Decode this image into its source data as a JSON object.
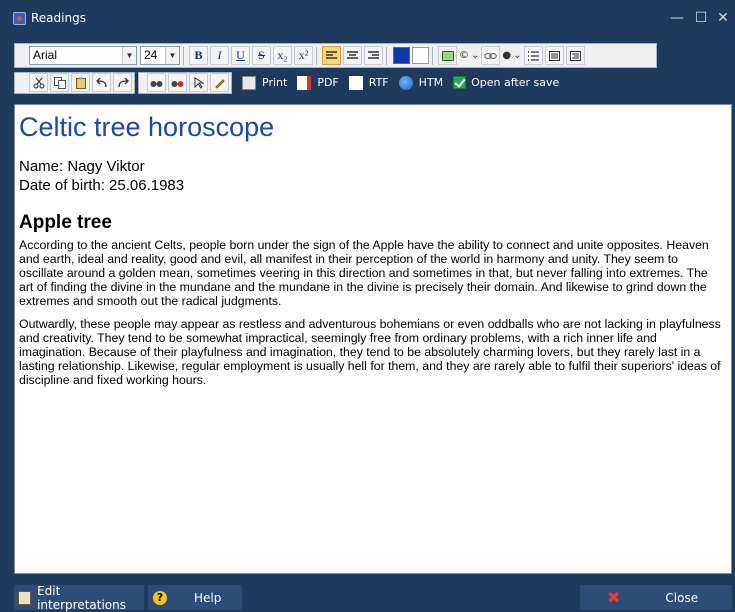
{
  "window": {
    "title": "Readings",
    "minimize_glyph": "—",
    "maximize_glyph": "☐",
    "close_glyph": "✕"
  },
  "toolbar": {
    "font": "Arial",
    "size": "24",
    "bold": "B",
    "italic": "I",
    "underline": "U",
    "strike": "S",
    "subscript": "x₂",
    "superscript": "x²",
    "print_label": "Print",
    "pdf_label": "PDF",
    "rtf_label": "RTF",
    "htm_label": "HTM",
    "open_after_save_label": "Open after save",
    "open_after_save_checked": true,
    "text_color": "#0b3aa8",
    "background_color": "#ffffff"
  },
  "document": {
    "title": "Celtic tree horoscope",
    "name_line": "Name: Nagy Viktor",
    "dob_line": "Date of birth: 25.06.1983",
    "tree": "Apple tree",
    "paragraph1": "According to the ancient Celts, people born under the sign of the Apple have the ability to connect and unite opposites. Heaven and earth, ideal and reality, good and evil, all manifest in their perception of the world in harmony and unity. They seem to oscillate around a golden mean, sometimes veering in this direction and sometimes in that, but never falling into extremes. The art of finding the divine in the mundane and the mundane in the divine is precisely their domain. And likewise to grind down the extremes and smooth out the radical judgments.",
    "paragraph2": "Outwardly, these people may appear as restless and adventurous bohemians or even oddballs who are not lacking in playfulness and creativity. They tend to be somewhat impractical, seemingly free from ordinary problems, with a rich inner life and imagination. Because of their playfulness and imagination, they tend to be absolutely charming lovers, but they rarely last in a lasting relationship. Likewise, regular employment is usually hell for them, and they are rarely able to fulfil their superiors' ideas of discipline and fixed working hours."
  },
  "footer": {
    "edit_label": "Edit interpretations",
    "help_label": "Help",
    "close_label": "Close"
  }
}
